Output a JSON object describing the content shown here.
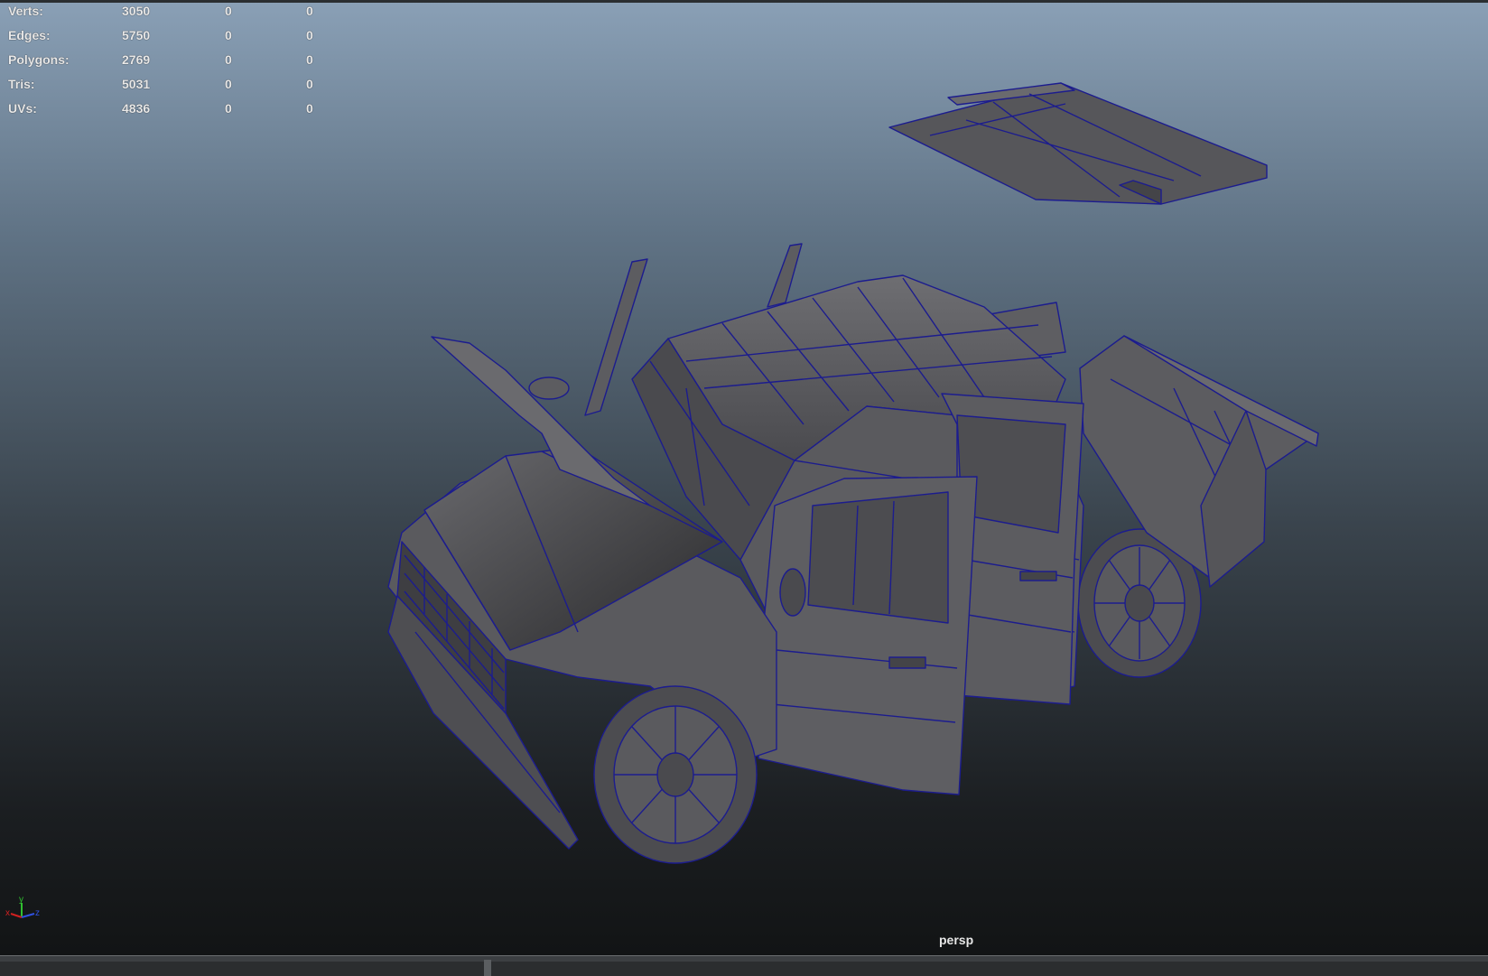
{
  "hud": {
    "stats": [
      {
        "label": "Verts:",
        "value": "3050",
        "sel1": "0",
        "sel2": "0"
      },
      {
        "label": "Edges:",
        "value": "5750",
        "sel1": "0",
        "sel2": "0"
      },
      {
        "label": "Polygons:",
        "value": "2769",
        "sel1": "0",
        "sel2": "0"
      },
      {
        "label": "Tris:",
        "value": "5031",
        "sel1": "0",
        "sel2": "0"
      },
      {
        "label": "UVs:",
        "value": "4836",
        "sel1": "0",
        "sel2": "0"
      }
    ]
  },
  "viewport": {
    "camera_label": "persp",
    "wireframe_color": "#1a1a8c",
    "shade_color": "#5a5a5e"
  },
  "axis_gizmo": {
    "x": "x",
    "y": "y",
    "z": "z",
    "x_color": "#d02020",
    "y_color": "#30c030",
    "z_color": "#3050e0"
  }
}
